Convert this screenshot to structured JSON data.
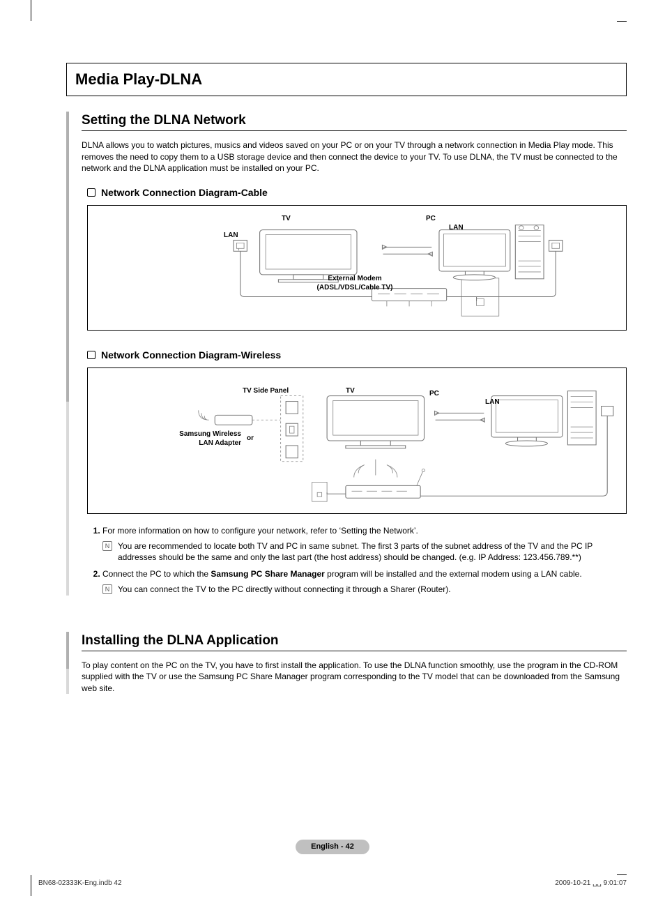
{
  "chapter_title": "Media Play-DLNA",
  "section1": {
    "title": "Setting the DLNA Network",
    "para": "DLNA allows you to watch pictures, musics and videos saved on your PC or on your TV through a network connection in Media Play mode. This removes the need to copy them to a USB storage device and then connect the device to your TV. To use DLNA, the TV must be connected to the network and the DLNA application must be installed on your PC.",
    "sub1": "Network Connection Diagram-Cable",
    "sub2": "Network Connection Diagram-Wireless"
  },
  "diagram1": {
    "tv": "TV",
    "pc": "PC",
    "lan_left": "LAN",
    "lan_right": "LAN",
    "modem_l1": "External Modem",
    "modem_l2": "(ADSL/VDSL/Cable TV)"
  },
  "diagram2": {
    "side_panel": "TV Side Panel",
    "tv": "TV",
    "pc": "PC",
    "lan": "LAN",
    "adapter_l1": "Samsung Wireless",
    "adapter_l2": "LAN Adapter",
    "or": "or"
  },
  "steps": [
    {
      "text_a": "For more information on how to configure your network, refer to ‘Setting the Network’.",
      "note": "You are recommended to locate both TV and PC in same subnet. The first 3 parts of the subnet address of the TV and the PC IP addresses should be the same and only the last part (the host address) should be changed. (e.g. IP Address: 123.456.789.**)"
    },
    {
      "text_a": "Connect the PC to which the ",
      "bold": "Samsung PC Share Manager",
      "text_b": " program will be installed and the external modem using a LAN cable.",
      "note": "You can connect the TV to the PC directly without connecting it through a Sharer (Router)."
    }
  ],
  "section2": {
    "title": "Installing the DLNA Application",
    "para": "To play content on the PC on the TV, you have to first install the application. To use the DLNA function smoothly, use the program in the CD-ROM supplied with the TV or use the Samsung PC Share Manager program corresponding to the TV model that can be downloaded from the Samsung web site."
  },
  "page_pill": "English - 42",
  "footer_left": "BN68-02333K-Eng.indb   42",
  "footer_right": "2009-10-21   ␣␣ 9:01:07"
}
